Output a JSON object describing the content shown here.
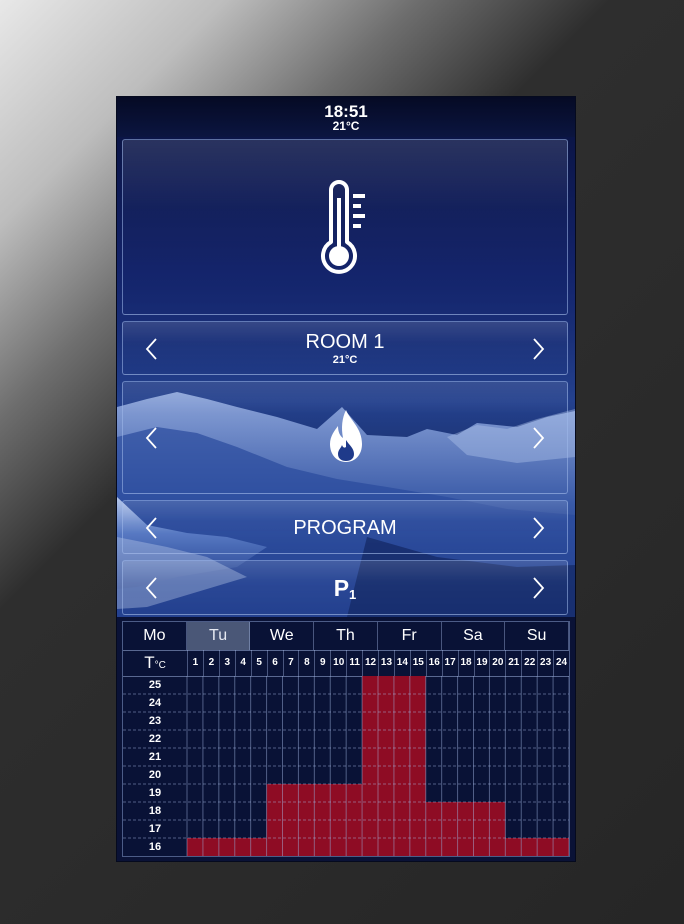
{
  "status": {
    "time": "18:51",
    "temperature": "21°C"
  },
  "icons": {
    "main": "thermometer-icon",
    "mode": "flame-icon",
    "prev": "chevron-left-icon",
    "next": "chevron-right-icon"
  },
  "room": {
    "name": "ROOM 1",
    "temperature": "21°C"
  },
  "program_label": "PROGRAM",
  "profile": {
    "name": "P",
    "subscript": "1"
  },
  "schedule": {
    "days": [
      "Mo",
      "Tu",
      "We",
      "Th",
      "Fr",
      "Sa",
      "Su"
    ],
    "selected_day": "Tu",
    "temp_unit_label": "T",
    "temp_unit_suffix": "°C",
    "hours": [
      "1",
      "2",
      "3",
      "4",
      "5",
      "6",
      "7",
      "8",
      "9",
      "10",
      "11",
      "12",
      "13",
      "14",
      "15",
      "16",
      "17",
      "18",
      "19",
      "20",
      "21",
      "22",
      "23",
      "24"
    ],
    "temps": [
      "25",
      "24",
      "23",
      "22",
      "21",
      "20",
      "19",
      "18",
      "17",
      "16"
    ],
    "setpoints": [
      16,
      16,
      16,
      16,
      16,
      19,
      19,
      19,
      19,
      19,
      19,
      25,
      25,
      25,
      25,
      18,
      18,
      18,
      18,
      18,
      16,
      16,
      16,
      16
    ],
    "bar_color": "#8e0c24"
  }
}
